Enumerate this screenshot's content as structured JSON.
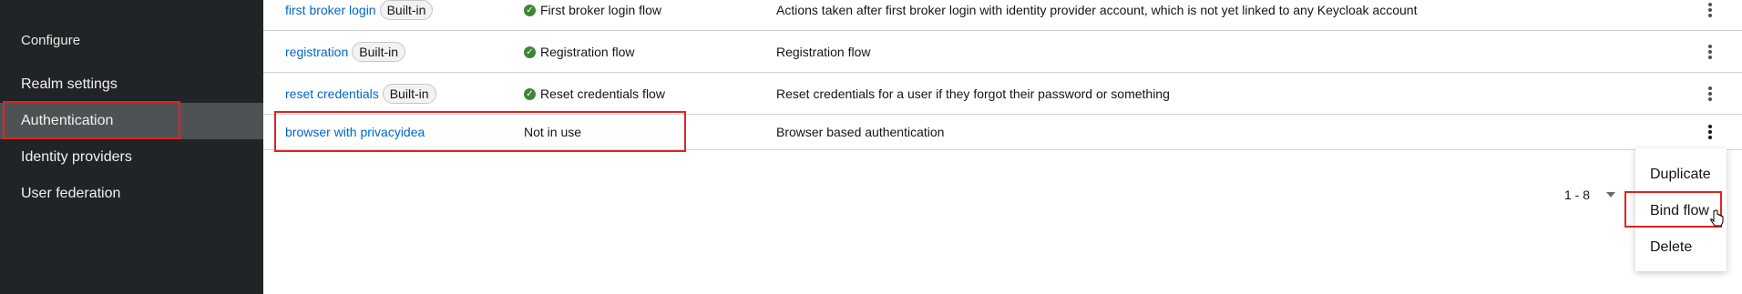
{
  "sidebar": {
    "section_title": "Configure",
    "items": [
      {
        "label": "Realm settings"
      },
      {
        "label": "Authentication"
      },
      {
        "label": "Identity providers"
      },
      {
        "label": "User federation"
      }
    ]
  },
  "flows": [
    {
      "name": "first broker login",
      "badge": "Built-in",
      "used_by": "First broker login flow",
      "description": "Actions taken after first broker login with identity provider account, which is not yet linked to any Keycloak account"
    },
    {
      "name": "registration",
      "badge": "Built-in",
      "used_by": "Registration flow",
      "description": "Registration flow"
    },
    {
      "name": "reset credentials",
      "badge": "Built-in",
      "used_by": "Reset credentials flow",
      "description": "Reset credentials for a user if they forgot their password or something"
    },
    {
      "name": "browser with privacyidea",
      "used_by": "Not in use",
      "description": "Browser based authentication"
    }
  ],
  "pagination": {
    "range": "1 - 8"
  },
  "menu": {
    "duplicate": "Duplicate",
    "bind_flow": "Bind flow",
    "delete": "Delete"
  },
  "icons": {
    "check": "check-circle-icon",
    "kebab": "kebab-icon",
    "caret": "caret-down-icon",
    "cursor": "hand-pointer-icon"
  },
  "colors": {
    "sidebar_bg": "#212427",
    "active_item_bg": "#4f5255",
    "link": "#0066cc",
    "success": "#3e8635",
    "highlight": "#e0231e"
  }
}
